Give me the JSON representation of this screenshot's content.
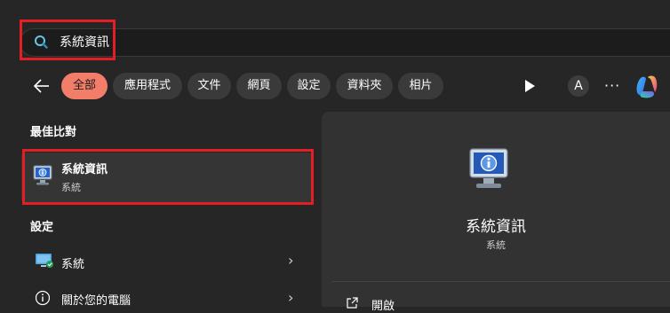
{
  "search": {
    "query": "系統資訊"
  },
  "filters": [
    {
      "label": "全部",
      "active": true
    },
    {
      "label": "應用程式"
    },
    {
      "label": "文件"
    },
    {
      "label": "網頁"
    },
    {
      "label": "設定"
    },
    {
      "label": "資料夾"
    },
    {
      "label": "相片"
    }
  ],
  "toolbar": {
    "avatar_letter": "A",
    "more_label": "···"
  },
  "best_match": {
    "header": "最佳比對",
    "title": "系統資訊",
    "subtitle": "系統"
  },
  "settings": {
    "header": "設定",
    "items": [
      {
        "label": "系統",
        "icon": "monitor-check-icon"
      },
      {
        "label": "關於您的電腦",
        "icon": "info-circle-icon"
      }
    ]
  },
  "detail": {
    "title": "系統資訊",
    "subtitle": "系統",
    "actions": [
      {
        "label": "開啟"
      }
    ]
  },
  "colors": {
    "background": "#262626",
    "accent_chip": "#f27e6a",
    "highlight_box": "#e31e24",
    "panel": "#323232"
  }
}
